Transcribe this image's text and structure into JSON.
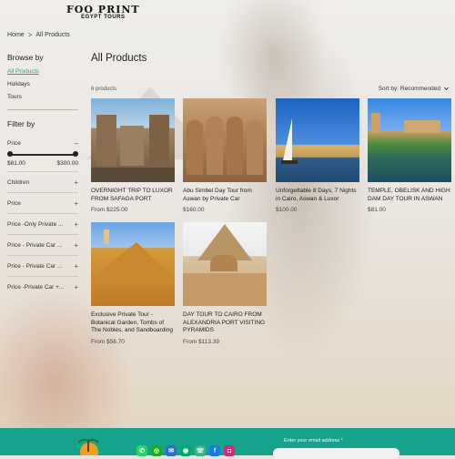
{
  "brand": {
    "line1": "FOO PRINT",
    "line2": "EGYPT TOURS"
  },
  "breadcrumb": {
    "home": "Home",
    "sep": ">",
    "current": "All Products"
  },
  "main": {
    "title": "All Products",
    "count": "6 products",
    "sort_label": "Sort by: Recommended"
  },
  "sidebar": {
    "browse_title": "Browse by",
    "categories": [
      {
        "label": "All Products",
        "active": true
      },
      {
        "label": "Holidays"
      },
      {
        "label": "Tours"
      }
    ],
    "filter_title": "Filter by",
    "price_filter": {
      "label": "Price",
      "sign": "–",
      "min": "$81.00",
      "max": "$300.00"
    },
    "filters": [
      {
        "label": "Children",
        "sign": "+"
      },
      {
        "label": "Price",
        "sign": "+"
      },
      {
        "label": "Price -Only Private ...",
        "sign": "+"
      },
      {
        "label": "Price - Private Car ...",
        "sign": "+"
      },
      {
        "label": "Price - Private Car ...",
        "sign": "+"
      },
      {
        "label": "Price -Private Car +...",
        "sign": "+"
      }
    ]
  },
  "products": [
    {
      "name": "OVERNIGHT TRIP TO LUXOR FROM SAFAGA PORT",
      "price": "From $225.00"
    },
    {
      "name": "Abu Simbel Day Tour from Aswan by Private Car",
      "price": "$160.00"
    },
    {
      "name": "Unforgettable 8 Days, 7 Nights in Cairo, Aswan & Luxor",
      "price": "$100.00"
    },
    {
      "name": "TEMPLE, OBELISK AND HIGH DAM DAY TOUR IN ASWAN",
      "price": "$81.00"
    },
    {
      "name": "Exclusive Private Tour - Botanical Garden, Tombs of The Nobles, and Sandboarding",
      "price": "From $56.70"
    },
    {
      "name": "DAY TOUR TO CAIRO FROM ALEXANDRIA PORT VISITING PYRAMIDS",
      "price": "From $113.39"
    }
  ],
  "footer": {
    "email_label": "Enter your email address *",
    "socials": [
      "whatsapp-icon",
      "wechat-icon",
      "email-icon",
      "tripadvisor-icon",
      "viber-icon",
      "facebook-icon",
      "instagram-icon"
    ]
  },
  "colors": {
    "accent_green": "#2fa36e",
    "footer_teal": "#16a38b"
  }
}
